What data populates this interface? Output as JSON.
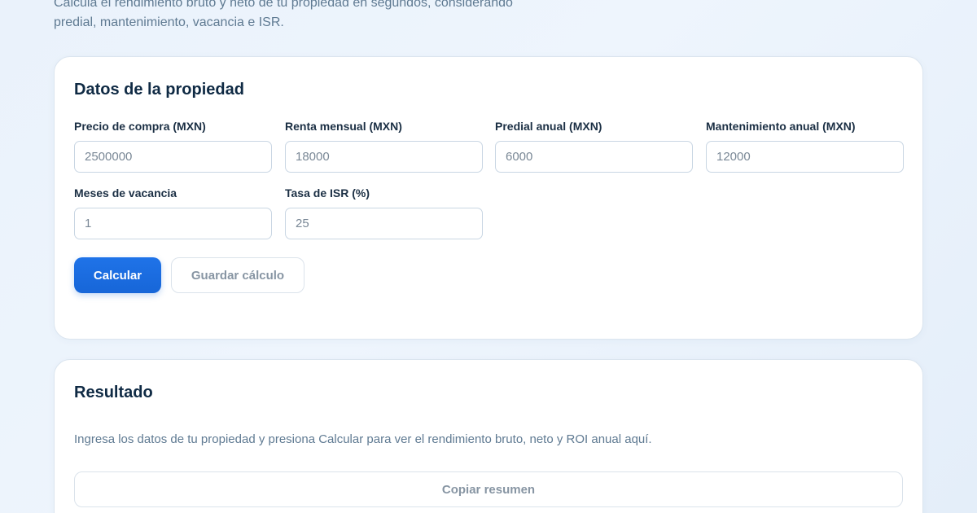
{
  "intro": {
    "line1": "Calcula el rendimiento bruto y neto de tu propiedad en segundos, considerando",
    "line2": "predial, mantenimiento, vacancia e ISR."
  },
  "form": {
    "title": "Datos de la propiedad",
    "fields": [
      {
        "label": "Precio de compra (MXN)",
        "placeholder": "2500000"
      },
      {
        "label": "Renta mensual (MXN)",
        "placeholder": "18000"
      },
      {
        "label": "Predial anual (MXN)",
        "placeholder": "6000"
      },
      {
        "label": "Mantenimiento anual (MXN)",
        "placeholder": "12000"
      },
      {
        "label": "Meses de vacancia",
        "placeholder": "1"
      },
      {
        "label": "Tasa de ISR (%)",
        "placeholder": "25"
      }
    ],
    "calculate_label": "Calcular",
    "save_label": "Guardar cálculo"
  },
  "result": {
    "title": "Resultado",
    "message": "Ingresa los datos de tu propiedad y presiona Calcular para ver el rendimiento bruto, neto y ROI anual aquí.",
    "copy_label": "Copiar resumen"
  },
  "colors": {
    "accent": "#1f73e8",
    "heading": "#0f2a44",
    "muted": "#5f7a92"
  }
}
